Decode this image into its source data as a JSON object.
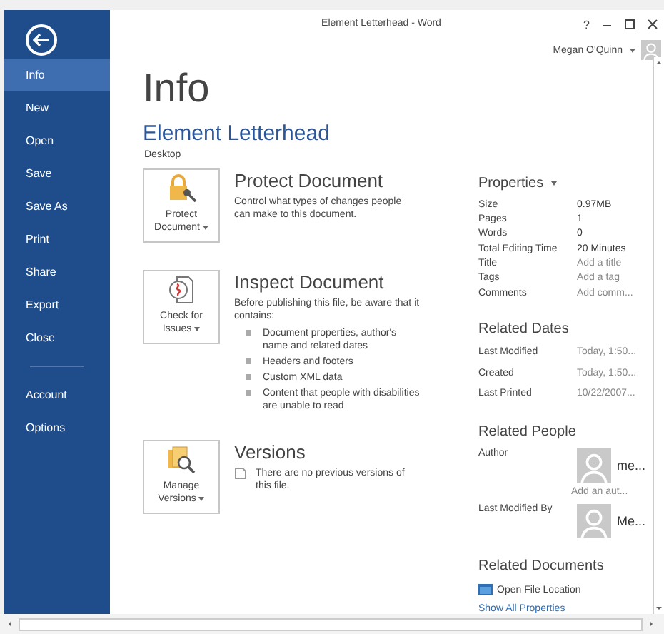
{
  "window": {
    "title": "Element Letterhead - Word",
    "help": "?"
  },
  "user": {
    "name": "Megan O'Quinn"
  },
  "sidebar": {
    "items": [
      {
        "label": "Info",
        "selected": true
      },
      {
        "label": "New",
        "selected": false
      },
      {
        "label": "Open",
        "selected": false
      },
      {
        "label": "Save",
        "selected": false
      },
      {
        "label": "Save As",
        "selected": false
      },
      {
        "label": "Print",
        "selected": false
      },
      {
        "label": "Share",
        "selected": false
      },
      {
        "label": "Export",
        "selected": false
      },
      {
        "label": "Close",
        "selected": false
      }
    ],
    "footer_items": [
      {
        "label": "Account",
        "selected": false
      },
      {
        "label": "Options",
        "selected": false
      }
    ]
  },
  "page_title": "Info",
  "document": {
    "name": "Element Letterhead",
    "location": "Desktop"
  },
  "sections": [
    {
      "kind": "protect",
      "button": "Protect Document",
      "heading": "Protect Document",
      "description": "Control what types of changes people can make to this document."
    },
    {
      "kind": "inspect",
      "button": "Check for Issues",
      "heading": "Inspect Document",
      "description": "Before publishing this file, be aware that it contains:",
      "bullets": [
        "Document properties, author's name and related dates",
        "Headers and footers",
        "Custom XML data",
        "Content that people with disabilities are unable to read"
      ]
    },
    {
      "kind": "versions",
      "button": "Manage Versions",
      "heading": "Versions",
      "note": "There are no previous versions of this file."
    }
  ],
  "properties": {
    "heading": "Properties",
    "rows": [
      {
        "label": "Size",
        "value": "0.97MB",
        "kind": "value"
      },
      {
        "label": "Pages",
        "value": "1",
        "kind": "value"
      },
      {
        "label": "Words",
        "value": "0",
        "kind": "value"
      },
      {
        "label": "Total Editing Time",
        "value": "20 Minutes",
        "kind": "value"
      },
      {
        "label": "Title",
        "placeholder": "Add a title",
        "kind": "field"
      },
      {
        "label": "Tags",
        "placeholder": "Add a tag",
        "kind": "field"
      },
      {
        "label": "Comments",
        "placeholder": "Add comm...",
        "kind": "field"
      }
    ]
  },
  "related_dates": {
    "heading": "Related Dates",
    "rows": [
      {
        "label": "Last Modified",
        "value": "Today, 1:50..."
      },
      {
        "label": "Created",
        "value": "Today, 1:50..."
      },
      {
        "label": "Last Printed",
        "value": "10/22/2007..."
      }
    ]
  },
  "related_people": {
    "heading": "Related People",
    "rows": [
      {
        "role": "Author",
        "name": "me...",
        "placeholder": "Add an aut..."
      },
      {
        "role": "Last Modified By",
        "name": "Me..."
      }
    ]
  },
  "related_documents": {
    "heading": "Related Documents",
    "link": "Open File Location"
  },
  "show_all": "Show All Properties"
}
